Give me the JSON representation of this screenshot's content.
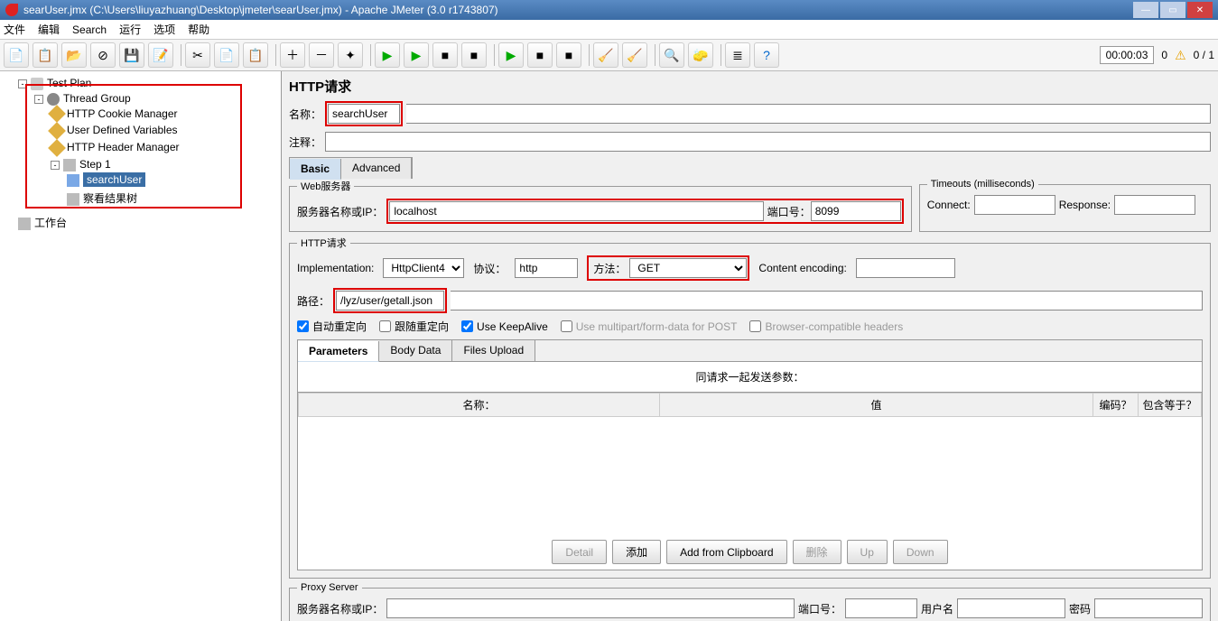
{
  "title": "searUser.jmx (C:\\Users\\liuyazhuang\\Desktop\\jmeter\\searUser.jmx) - Apache JMeter (3.0 r1743807)",
  "menu": [
    "文件",
    "编辑",
    "Search",
    "运行",
    "选项",
    "帮助"
  ],
  "status": {
    "timer": "00:00:03",
    "zero": "0",
    "ratio": "0 / 1"
  },
  "tree": {
    "root": "Test Plan",
    "threadGroup": "Thread Group",
    "cookieMgr": "HTTP Cookie Manager",
    "userVars": "User Defined Variables",
    "headerMgr": "HTTP Header Manager",
    "step1": "Step 1",
    "searchUser": "searchUser",
    "viewTree": "察看结果树",
    "workbench": "工作台"
  },
  "form": {
    "heading": "HTTP请求",
    "nameLabel": "名称：",
    "nameValue": "searchUser",
    "commentLabel": "注释：",
    "tab1": "Basic",
    "tab2": "Advanced",
    "webLegend": "Web服务器",
    "serverLabel": "服务器名称或IP：",
    "serverValue": "localhost",
    "portLabel": "端口号：",
    "portValue": "8099",
    "timeoutLegend": "Timeouts (milliseconds)",
    "connectLabel": "Connect:",
    "responseLabel": "Response:",
    "httpLegend": "HTTP请求",
    "implLabel": "Implementation:",
    "implValue": "HttpClient4",
    "protoLabel": "协议：",
    "protoValue": "http",
    "methodLabel": "方法：",
    "methodValue": "GET",
    "encodingLabel": "Content encoding:",
    "pathLabel": "路径：",
    "pathValue": "/lyz/user/getall.json",
    "cbAutoRedirect": "自动重定向",
    "cbFollowRedirect": "跟随重定向",
    "cbKeepAlive": "Use KeepAlive",
    "cbMultipart": "Use multipart/form-data for POST",
    "cbBrowserCompat": "Browser-compatible headers",
    "paramTab1": "Parameters",
    "paramTab2": "Body Data",
    "paramTab3": "Files Upload",
    "paramCaption": "同请求一起发送参数：",
    "colName": "名称：",
    "colValue": "值",
    "colEncode": "编码？",
    "colInclude": "包含等于？",
    "btnDetail": "Detail",
    "btnAdd": "添加",
    "btnClipboard": "Add from Clipboard",
    "btnDelete": "删除",
    "btnUp": "Up",
    "btnDown": "Down",
    "proxyLegend": "Proxy Server",
    "proxyServer": "服务器名称或IP：",
    "proxyPort": "端口号：",
    "proxyUser": "用户名",
    "proxyPass": "密码"
  }
}
